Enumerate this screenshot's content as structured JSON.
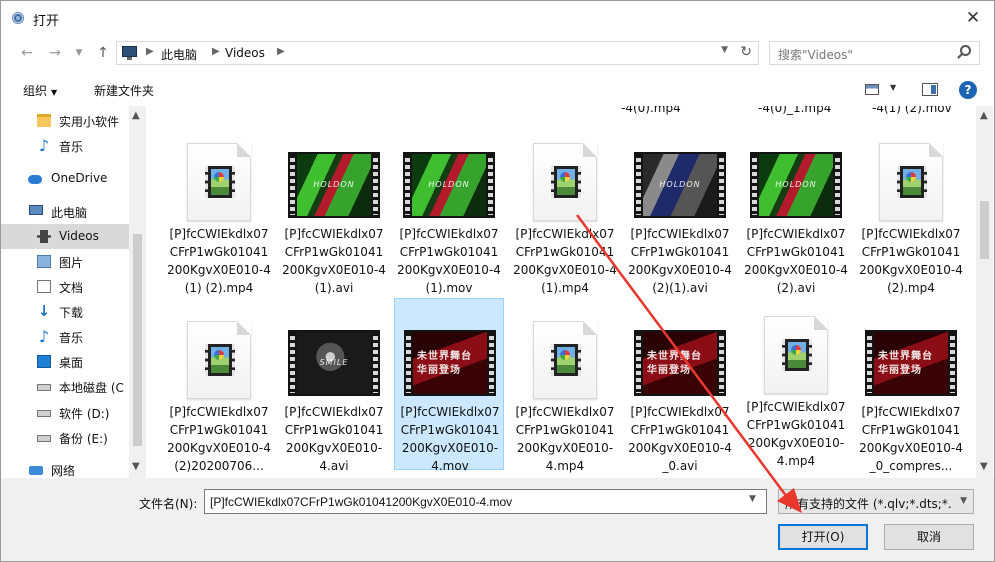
{
  "window": {
    "title": "打开"
  },
  "address": {
    "crumbs": [
      "此电脑",
      "Videos"
    ],
    "search_placeholder": "搜索\"Videos\""
  },
  "toolbar": {
    "organize_label": "组织",
    "new_folder_label": "新建文件夹",
    "help_label": "?"
  },
  "nav": {
    "items": [
      {
        "label": "实用小软件",
        "icon": "folder-icon"
      },
      {
        "label": "音乐",
        "icon": "music-icon"
      },
      {
        "label": "OneDrive",
        "icon": "cloud-icon"
      },
      {
        "label": "此电脑",
        "icon": "computer-icon"
      },
      {
        "label": "Videos",
        "icon": "videos-icon"
      },
      {
        "label": "图片",
        "icon": "pictures-icon"
      },
      {
        "label": "文档",
        "icon": "documents-icon"
      },
      {
        "label": "下载",
        "icon": "download-icon"
      },
      {
        "label": "音乐",
        "icon": "music-icon"
      },
      {
        "label": "桌面",
        "icon": "desktop-icon"
      },
      {
        "label": "本地磁盘 (C",
        "icon": "drive-icon"
      },
      {
        "label": "软件 (D:)",
        "icon": "drive-icon"
      },
      {
        "label": "备份 (E:)",
        "icon": "drive-icon"
      },
      {
        "label": "网络",
        "icon": "network-icon"
      }
    ]
  },
  "content": {
    "top_partial": [
      "-4(0).mp4",
      "-4(0)_1.mp4",
      "-4(1) (2).mov"
    ],
    "files": [
      {
        "name": "[P]fcCWIEkdlx07CFrP1wGk01041200KgvX0E010-4(1) (2).mp4",
        "thumb": "doc"
      },
      {
        "name": "[P]fcCWIEkdlx07CFrP1wGk01041200KgvX0E010-4(1).avi",
        "thumb": "green",
        "caption": "HOLDON"
      },
      {
        "name": "[P]fcCWIEkdlx07CFrP1wGk01041200KgvX0E010-4(1).mov",
        "thumb": "green",
        "caption": "HOLDON"
      },
      {
        "name": "[P]fcCWIEkdlx07CFrP1wGk01041200KgvX0E010-4(1).mp4",
        "thumb": "doc"
      },
      {
        "name": "[P]fcCWIEkdlx07CFrP1wGk01041200KgvX0E010-4(2)(1).avi",
        "thumb": "blue",
        "caption": "HOLDON"
      },
      {
        "name": "[P]fcCWIEkdlx07CFrP1wGk01041200KgvX0E010-4(2).avi",
        "thumb": "green",
        "caption": "HOLDON"
      },
      {
        "name": "[P]fcCWIEkdlx07CFrP1wGk01041200KgvX0E010-4(2).mp4",
        "thumb": "doc"
      },
      {
        "name": "[P]fcCWIEkdlx07CFrP1wGk01041200KgvX0E010-4(2)20200706...",
        "thumb": "doc"
      },
      {
        "name": "[P]fcCWIEkdlx07CFrP1wGk01041200KgvX0E010-4.avi",
        "thumb": "bw",
        "caption": "SMILE"
      },
      {
        "name": "[P]fcCWIEkdlx07CFrP1wGk01041200KgvX0E010-4.mov",
        "thumb": "red",
        "caption": "未世界舞台 华丽登场",
        "selected": true
      },
      {
        "name": "[P]fcCWIEkdlx07CFrP1wGk01041200KgvX0E010-4.mp4",
        "thumb": "doc"
      },
      {
        "name": "[P]fcCWIEkdlx07CFrP1wGk01041200KgvX0E010-4_0.avi",
        "thumb": "red",
        "caption": "未世界舞台 华丽登场"
      },
      {
        "name": "[P]fcCWIEkdlx07CFrP1wGk01041200KgvX0E010-4.mp4",
        "thumb": "doc"
      },
      {
        "name": "[P]fcCWIEkdlx07CFrP1wGk01041200KgvX0E010-4_0_compres...",
        "thumb": "red",
        "caption": "未世界舞台 华丽登场"
      }
    ]
  },
  "bottom": {
    "filename_label": "文件名(N):",
    "filename_value": "[P]fcCWIEkdlx07CFrP1wGk01041200KgvX0E010-4.mov",
    "filter_value": "所有支持的文件 (*.qlv;*.dts;*.w",
    "open_label": "打开(O)",
    "cancel_label": "取消"
  },
  "colors": {
    "selection": "#cce8ff",
    "accent": "#0078d7",
    "annotation_arrow": "#e8382e"
  }
}
